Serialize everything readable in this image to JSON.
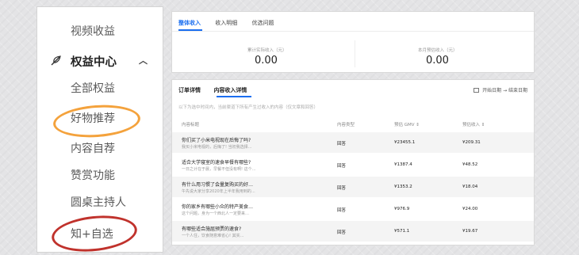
{
  "sidebar": {
    "video_income": "视频收益",
    "section_title": "权益中心",
    "items": [
      "全部权益",
      "好物推荐",
      "内容自荐",
      "赞赏功能",
      "圆桌主持人",
      "知+自选"
    ]
  },
  "summary": {
    "tabs": [
      "整体收入",
      "收入明细",
      "优选问题"
    ],
    "stats": [
      {
        "label": "累计实际收入（元）",
        "value": "0.00"
      },
      {
        "label": "本月预估收入（元）",
        "value": "0.00"
      }
    ]
  },
  "detail": {
    "tabs": [
      "订单详情",
      "内容收入详情"
    ],
    "date_range": "开始日期 → 结束日期",
    "description": "以下为选中时间内，当前渠道下所有产生过收入的内容（仅文章和回答）",
    "columns": [
      "内容标题",
      "内容类型",
      "预估 GMV ⇕",
      "预估收入 ⇕"
    ],
    "rows": [
      {
        "title": "你们买了小米电视现在后悔了吗?",
        "sub": "我买小米电视的，后悔了! 当初我选择…",
        "type": "回答",
        "gmv": "¥23455.1",
        "income": "¥209.31"
      },
      {
        "title": "适合大学寝室的速食早餐有哪些?",
        "sub": "一日之计在于晨，早餐不但没有啊! 这个…",
        "type": "回答",
        "gmv": "¥1387.4",
        "income": "¥48.52"
      },
      {
        "title": "有什么用习惯了会量复购买的好…",
        "sub": "午先说大家分享2020年上半年我用到的…",
        "type": "回答",
        "gmv": "¥1353.2",
        "income": "¥18.04"
      },
      {
        "title": "你的家乡有哪些小众的特产美食…",
        "sub": "这个问题，身为一个西北人一定要来…",
        "type": "回答",
        "gmv": "¥976.9",
        "income": "¥24.00"
      },
      {
        "title": "有哪些适合施屈预贾的速食?",
        "sub": "一个人住，饮食随意难省心! 其实…",
        "type": "回答",
        "gmv": "¥571.1",
        "income": "¥19.67"
      }
    ]
  },
  "colors": {
    "accent": "#1a6ef0",
    "orange_circle": "#f4a23c",
    "red_circle": "#c0322c"
  }
}
